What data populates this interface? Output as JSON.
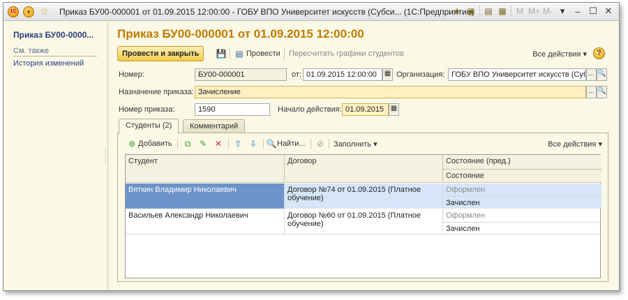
{
  "window": {
    "logo_text": "1С",
    "title": "Приказ БУ00-000001 от 01.09.2015 12:00:00 - ГОБУ ВПО Университет искусств (Субси...   (1С:Предприятие)",
    "toolbar_letters": [
      "M",
      "M+",
      "M-"
    ]
  },
  "sidebar": {
    "title": "Приказ БУ00-0000...",
    "see_also": "См. также",
    "items": [
      {
        "label": "История изменений"
      }
    ]
  },
  "document": {
    "heading": "Приказ БУ00-000001 от 01.09.2015 12:00:00"
  },
  "toolbar": {
    "post_close": "Провести и закрыть",
    "post": "Провести",
    "recalc": "Пересчитать графики студентов",
    "all_actions": "Все действия",
    "help": "?"
  },
  "form": {
    "number_label": "Номер:",
    "number_value": "БУ00-000001",
    "from_label": "от:",
    "date_value": "01.09.2015 12:00:00",
    "org_label": "Организация:",
    "org_value": "ГОБУ ВПО Университет искусств (Суб",
    "purpose_label": "Назначение приказа:",
    "purpose_value": "Зачисление",
    "order_number_label": "Номер приказа:",
    "order_number_value": "1590",
    "start_label": "Начало действия:",
    "start_value": "01.09.2015",
    "ellipsis": "...",
    "search": "🔍"
  },
  "tabs": [
    {
      "label": "Студенты (2)",
      "active": true
    },
    {
      "label": "Комментарий",
      "active": false
    }
  ],
  "table_toolbar": {
    "add": "Добавить",
    "find": "Найти...",
    "fill": "Заполнить",
    "all_actions": "Все действия"
  },
  "table": {
    "headers": {
      "student": "Студент",
      "contract": "Договор",
      "state_prev": "Состояние (пред.)",
      "state": "Состояние"
    },
    "rows": [
      {
        "student": "Вяткин Владимир Николаевич",
        "contract": "Договор №74 от 01.09.2015 (Платное обучение)",
        "state_prev": "Оформлен",
        "state": "Зачислен",
        "selected": true
      },
      {
        "student": "Васильев Александр Николаевич",
        "contract": "Договор №60 от 01.09.2015 (Платное обучение)",
        "state_prev": "Оформлен",
        "state": "Зачислен",
        "selected": false
      }
    ]
  }
}
